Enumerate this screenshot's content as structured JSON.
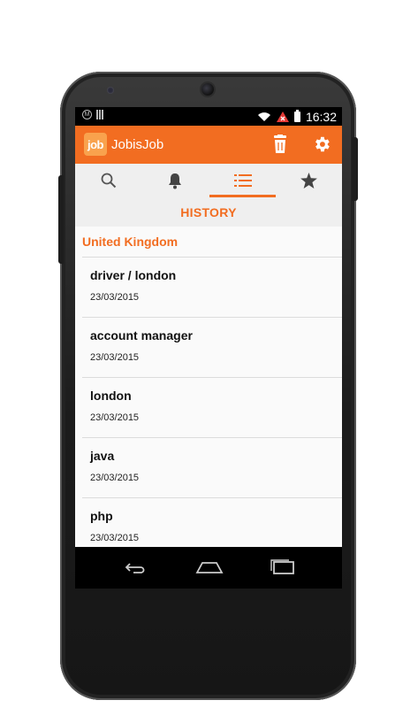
{
  "status_bar": {
    "time": "16:32",
    "icons": [
      "motorola-logo-icon",
      "signal-bars-icon",
      "wifi-icon",
      "no-sim-icon",
      "battery-icon"
    ]
  },
  "app_bar": {
    "logo_text": "job",
    "title": "JobisJob",
    "actions": [
      "trash-icon",
      "gear-icon"
    ]
  },
  "tabs": [
    {
      "icon": "search-icon",
      "active": false
    },
    {
      "icon": "bell-icon",
      "active": false
    },
    {
      "icon": "list-icon",
      "active": true
    },
    {
      "icon": "star-icon",
      "active": false
    }
  ],
  "section_header": "HISTORY",
  "country": "United Kingdom",
  "history": [
    {
      "title": "driver / london",
      "date": "23/03/2015"
    },
    {
      "title": "account manager",
      "date": "23/03/2015"
    },
    {
      "title": "london",
      "date": "23/03/2015"
    },
    {
      "title": "java",
      "date": "23/03/2015"
    },
    {
      "title": "php",
      "date": "23/03/2015"
    }
  ],
  "nav_bar": [
    "back-icon",
    "home-icon",
    "recents-icon"
  ],
  "colors": {
    "accent": "#f26d21",
    "logo_bg": "#f9a24d",
    "tab_bg": "#efefef",
    "inactive_icon": "#555555"
  }
}
